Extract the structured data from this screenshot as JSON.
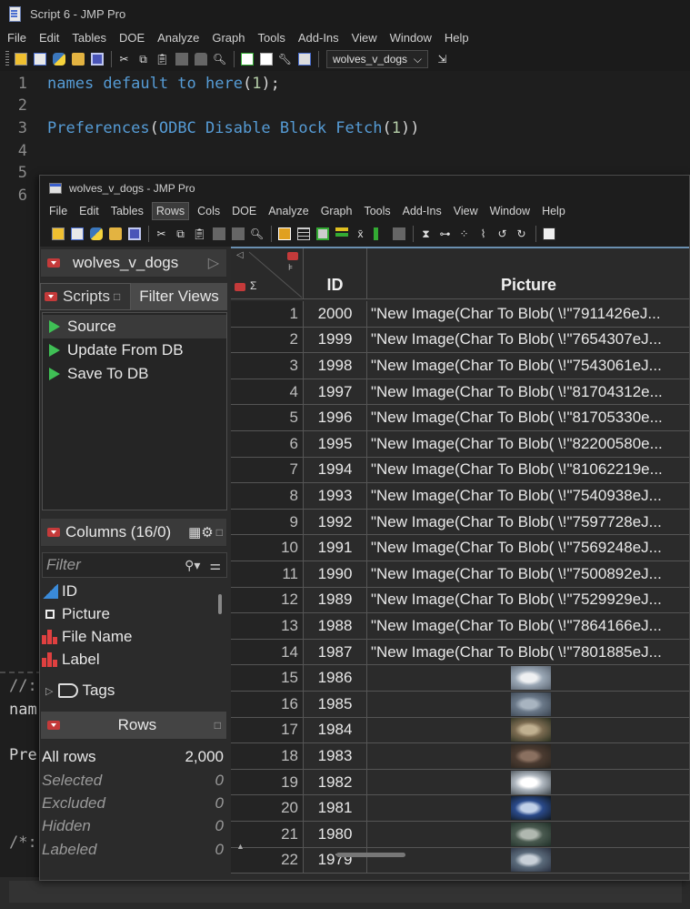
{
  "script_window": {
    "title": "Script 6 - JMP Pro",
    "menu": [
      "File",
      "Edit",
      "Tables",
      "DOE",
      "Analyze",
      "Graph",
      "Tools",
      "Add-Ins",
      "View",
      "Window",
      "Help"
    ],
    "table_dropdown": "wolves_v_dogs",
    "code_lines": [
      {
        "n": "1",
        "text": "names default to here(1);"
      },
      {
        "n": "2",
        "text": ""
      },
      {
        "n": "3",
        "text": "Preferences(ODBC Disable Block Fetch(1))"
      },
      {
        "n": "4",
        "text": ""
      },
      {
        "n": "5",
        "text": ""
      },
      {
        "n": "6",
        "text": ""
      }
    ],
    "log_fragments": [
      "//:",
      "nam",
      "Pre",
      "/*:"
    ]
  },
  "data_window": {
    "title": "wolves_v_dogs - JMP Pro",
    "menu": [
      "File",
      "Edit",
      "Tables",
      "Rows",
      "Cols",
      "DOE",
      "Analyze",
      "Graph",
      "Tools",
      "Add-Ins",
      "View",
      "Window",
      "Help"
    ],
    "active_menu": "Rows",
    "table_name": "wolves_v_dogs",
    "tabs": {
      "scripts": "Scripts",
      "filter_views": "Filter Views"
    },
    "scripts": [
      "Source",
      "Update From DB",
      "Save To DB"
    ],
    "columns_header": "Columns (16/0)",
    "filter_placeholder": "Filter",
    "columns": [
      "ID",
      "Picture",
      "File Name",
      "Label"
    ],
    "tags_label": "Tags",
    "rows_header": "Rows",
    "row_stats": [
      {
        "label": "All rows",
        "value": "2,000"
      },
      {
        "label": "Selected",
        "value": "0"
      },
      {
        "label": "Excluded",
        "value": "0"
      },
      {
        "label": "Hidden",
        "value": "0"
      },
      {
        "label": "Labeled",
        "value": "0"
      }
    ],
    "grid": {
      "headers": {
        "id": "ID",
        "picture": "Picture",
        "sigma": "Σ"
      },
      "text_rows": [
        {
          "rn": "1",
          "id": "2000",
          "pic": "\"New Image(Char To Blob( \\!\"7911426eJ..."
        },
        {
          "rn": "2",
          "id": "1999",
          "pic": "\"New Image(Char To Blob( \\!\"7654307eJ..."
        },
        {
          "rn": "3",
          "id": "1998",
          "pic": "\"New Image(Char To Blob( \\!\"7543061eJ..."
        },
        {
          "rn": "4",
          "id": "1997",
          "pic": "\"New Image(Char To Blob( \\!\"81704312e..."
        },
        {
          "rn": "5",
          "id": "1996",
          "pic": "\"New Image(Char To Blob( \\!\"81705330e..."
        },
        {
          "rn": "6",
          "id": "1995",
          "pic": "\"New Image(Char To Blob( \\!\"82200580e..."
        },
        {
          "rn": "7",
          "id": "1994",
          "pic": "\"New Image(Char To Blob( \\!\"81062219e..."
        },
        {
          "rn": "8",
          "id": "1993",
          "pic": "\"New Image(Char To Blob( \\!\"7540938eJ..."
        },
        {
          "rn": "9",
          "id": "1992",
          "pic": "\"New Image(Char To Blob( \\!\"7597728eJ..."
        },
        {
          "rn": "10",
          "id": "1991",
          "pic": "\"New Image(Char To Blob( \\!\"7569248eJ..."
        },
        {
          "rn": "11",
          "id": "1990",
          "pic": "\"New Image(Char To Blob( \\!\"7500892eJ..."
        },
        {
          "rn": "12",
          "id": "1989",
          "pic": "\"New Image(Char To Blob( \\!\"7529929eJ..."
        },
        {
          "rn": "13",
          "id": "1988",
          "pic": "\"New Image(Char To Blob( \\!\"7864166eJ..."
        },
        {
          "rn": "14",
          "id": "1987",
          "pic": "\"New Image(Char To Blob( \\!\"7801885eJ..."
        }
      ],
      "image_rows": [
        {
          "rn": "15",
          "id": "1986"
        },
        {
          "rn": "16",
          "id": "1985"
        },
        {
          "rn": "17",
          "id": "1984"
        },
        {
          "rn": "18",
          "id": "1983"
        },
        {
          "rn": "19",
          "id": "1982"
        },
        {
          "rn": "20",
          "id": "1981"
        },
        {
          "rn": "21",
          "id": "1980"
        },
        {
          "rn": "22",
          "id": "1979"
        }
      ]
    }
  }
}
